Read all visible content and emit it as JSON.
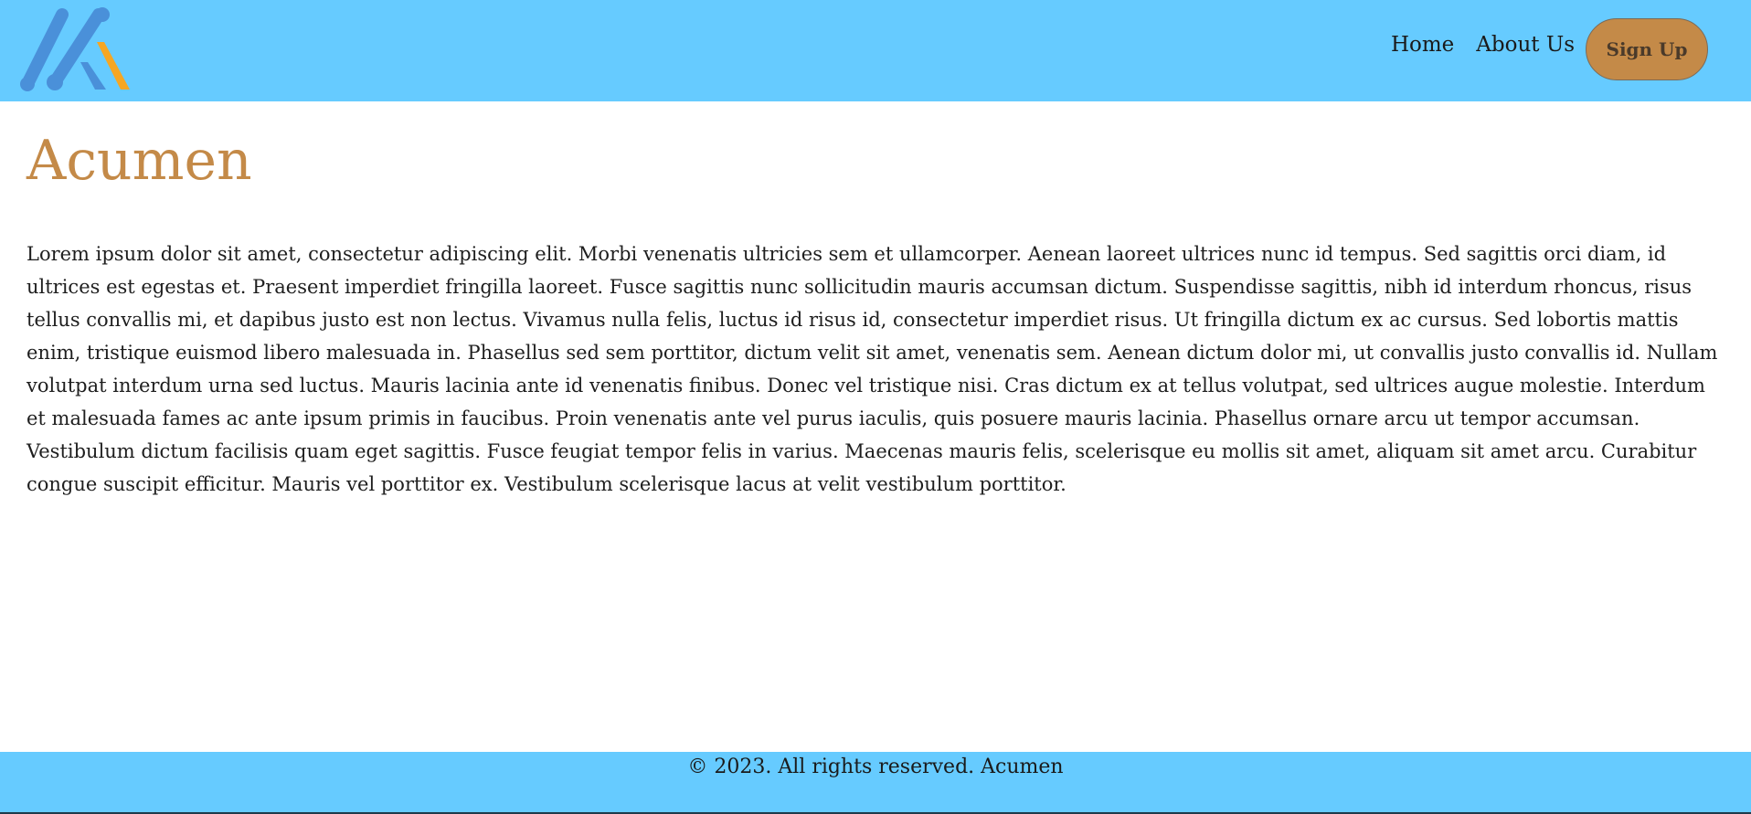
{
  "header": {
    "logo_icon": "acumen-logo-icon",
    "nav": {
      "home_label": "Home",
      "about_label": "About Us",
      "signup_label": "Sign Up"
    }
  },
  "main": {
    "title": "Acumen",
    "body": "Lorem ipsum dolor sit amet, consectetur adipiscing elit. Morbi venenatis ultricies sem et ullamcorper. Aenean laoreet ultrices nunc id tempus. Sed sagittis orci diam, id ultrices est egestas et. Praesent imperdiet fringilla laoreet. Fusce sagittis nunc sollicitudin mauris accumsan dictum. Suspendisse sagittis, nibh id interdum rhoncus, risus tellus convallis mi, et dapibus justo est non lectus. Vivamus nulla felis, luctus id risus id, consectetur imperdiet risus. Ut fringilla dictum ex ac cursus. Sed lobortis mattis enim, tristique euismod libero malesuada in. Phasellus sed sem porttitor, dictum velit sit amet, venenatis sem. Aenean dictum dolor mi, ut convallis justo convallis id. Nullam volutpat interdum urna sed luctus. Mauris lacinia ante id venenatis finibus. Donec vel tristique nisi. Cras dictum ex at tellus volutpat, sed ultrices augue molestie. Interdum et malesuada fames ac ante ipsum primis in faucibus. Proin venenatis ante vel purus iaculis, quis posuere mauris lacinia. Phasellus ornare arcu ut tempor accumsan. Vestibulum dictum facilisis quam eget sagittis. Fusce feugiat tempor felis in varius. Maecenas mauris felis, scelerisque eu mollis sit amet, aliquam sit amet arcu. Curabitur congue suscipit efficitur. Mauris vel porttitor ex. Vestibulum scelerisque lacus at velit vestibulum porttitor."
  },
  "footer": {
    "text": "© 2023. All rights reserved. Acumen"
  },
  "colors": {
    "header_bg": "#66cbff",
    "accent": "#c48a48",
    "logo_blue": "#4a90d9",
    "logo_orange": "#f5a623"
  }
}
